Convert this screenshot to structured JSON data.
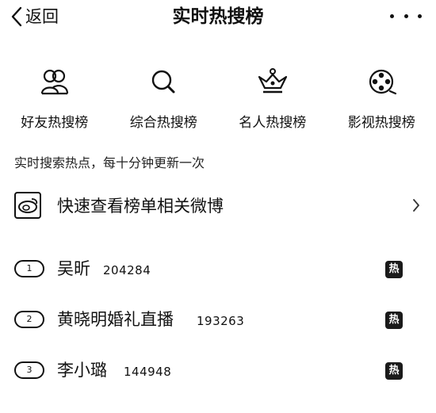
{
  "nav": {
    "back_label": "返回",
    "title": "实时热搜榜"
  },
  "categories": [
    {
      "label": "好友热搜榜",
      "icon": "friends-icon"
    },
    {
      "label": "综合热搜榜",
      "icon": "search-icon"
    },
    {
      "label": "名人热搜榜",
      "icon": "crown-icon"
    },
    {
      "label": "影视热搜榜",
      "icon": "film-reel-icon"
    }
  ],
  "subtitle": "实时搜索热点，每十分钟更新一次",
  "quick_view": {
    "label": "快速查看榜单相关微博",
    "icon": "weibo-logo-icon"
  },
  "hot_items": [
    {
      "rank": "1",
      "title": "吴昕",
      "count": "204284",
      "badge": "热"
    },
    {
      "rank": "2",
      "title": "黄晓明婚礼直播",
      "count": "193263",
      "badge": "热"
    },
    {
      "rank": "3",
      "title": "李小璐",
      "count": "144948",
      "badge": "热"
    }
  ],
  "colors": {
    "text": "#111111",
    "background": "#ffffff",
    "badge": "#1a1a1a"
  }
}
